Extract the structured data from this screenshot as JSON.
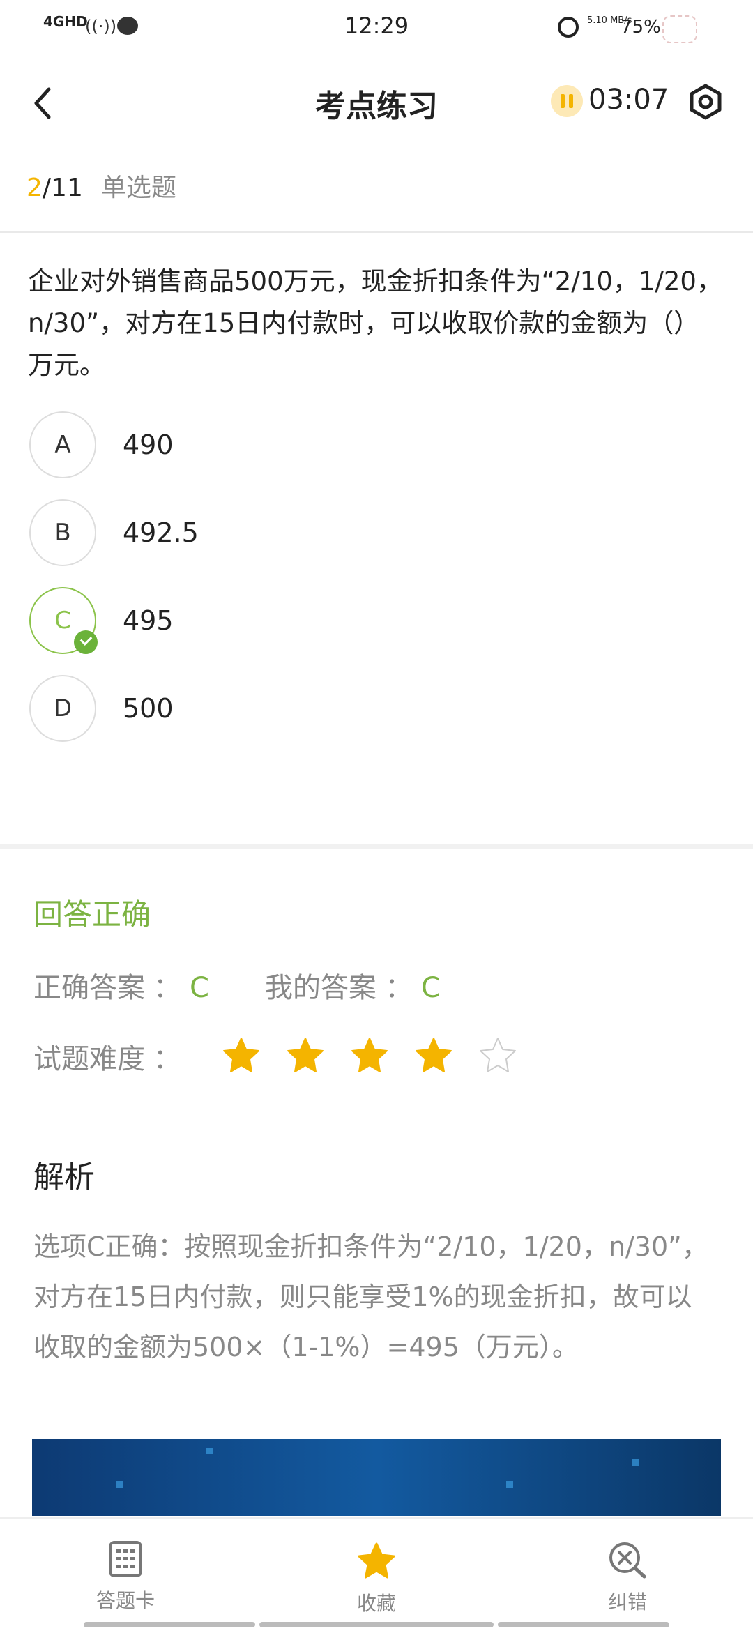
{
  "status_bar": {
    "network": "4GHD",
    "time": "12:29",
    "speed": "5.10 MB/s",
    "battery": "75%"
  },
  "header": {
    "title": "考点练习",
    "timer": "03:07"
  },
  "question_meta": {
    "current": "2",
    "total": "/11",
    "type": "单选题"
  },
  "question": {
    "text": "企业对外销售商品500万元，现金折扣条件为“2/10，1/20，n/30”，对方在15日内付款时，可以收取价款的金额为（）万元。",
    "options": [
      {
        "letter": "A",
        "value": "490"
      },
      {
        "letter": "B",
        "value": "492.5"
      },
      {
        "letter": "C",
        "value": "495"
      },
      {
        "letter": "D",
        "value": "500"
      }
    ],
    "selected": "C"
  },
  "result": {
    "status": "回答正确",
    "correct_label": "正确答案",
    "correct_answer": "C",
    "my_label": "我的答案",
    "my_answer": "C",
    "difficulty_label": "试题难度",
    "difficulty_stars": 4,
    "difficulty_max": 5
  },
  "analysis": {
    "title": "解析",
    "text": "选项C正确：按照现金折扣条件为“2/10，1/20，n/30”，对方在15日内付款，则只能享受1%的现金折扣，故可以收取的金额为500×（1-1%）=495（万元）。"
  },
  "bottom_tabs": [
    {
      "label": "答题卡",
      "icon": "answer-card-icon"
    },
    {
      "label": "收藏",
      "icon": "star-icon"
    },
    {
      "label": "纠错",
      "icon": "error-search-icon"
    }
  ],
  "colors": {
    "accent_yellow": "#f4b400",
    "correct_green": "#7cb342"
  }
}
